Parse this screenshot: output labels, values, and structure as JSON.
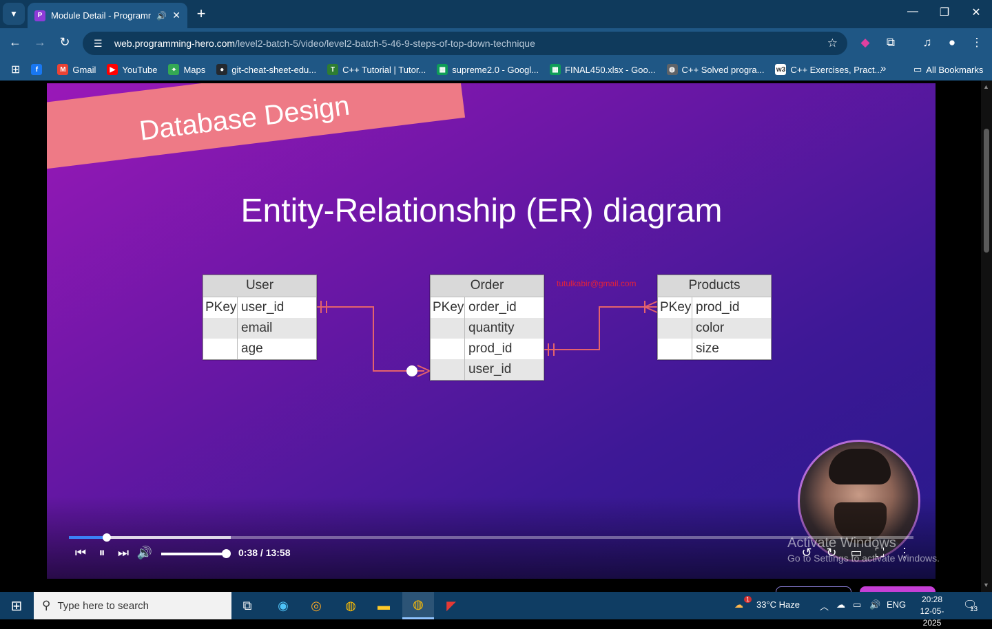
{
  "browser": {
    "tab_title": "Module Detail - Programmi",
    "new_tab": "+",
    "url_domain": "web.programming-hero.com",
    "url_path": "/level2-batch-5/video/level2-batch-5-46-9-steps-of-top-down-technique"
  },
  "bookmarks": [
    {
      "label": "",
      "icon": "facebook-icon",
      "color": "#1877f2"
    },
    {
      "label": "Gmail",
      "icon": "gmail-icon",
      "color": "#ea4335"
    },
    {
      "label": "YouTube",
      "icon": "youtube-icon",
      "color": "#ff0000"
    },
    {
      "label": "Maps",
      "icon": "maps-icon",
      "color": "#34a853"
    },
    {
      "label": "git-cheat-sheet-edu...",
      "icon": "github-icon",
      "color": "#24292f"
    },
    {
      "label": "C++ Tutorial | Tutor...",
      "icon": "tutorial-icon",
      "color": "#2e7d32"
    },
    {
      "label": "supreme2.0 - Googl...",
      "icon": "sheets-icon",
      "color": "#0f9d58"
    },
    {
      "label": "FINAL450.xlsx - Goo...",
      "icon": "sheets-icon",
      "color": "#0f9d58"
    },
    {
      "label": "C++ Solved progra...",
      "icon": "globe-icon",
      "color": "#5f6368"
    },
    {
      "label": "C++ Exercises, Pract...",
      "icon": "w3r-icon",
      "color": "#ffffff"
    }
  ],
  "all_bookmarks": "All Bookmarks",
  "slide": {
    "banner": "Database Design",
    "title": "Entity-Relationship (ER) diagram",
    "email": "tutulkabir@gmail.com",
    "tables": [
      {
        "name": "User",
        "rows": [
          {
            "key": "PKey",
            "field": "user_id"
          },
          {
            "key": "",
            "field": "email"
          },
          {
            "key": "",
            "field": "age"
          }
        ]
      },
      {
        "name": "Order",
        "rows": [
          {
            "key": "PKey",
            "field": "order_id"
          },
          {
            "key": "",
            "field": "quantity"
          },
          {
            "key": "",
            "field": "prod_id"
          },
          {
            "key": "",
            "field": "user_id"
          }
        ]
      },
      {
        "name": "Products",
        "rows": [
          {
            "key": "PKey",
            "field": "prod_id"
          },
          {
            "key": "",
            "field": "color"
          },
          {
            "key": "",
            "field": "size"
          }
        ]
      }
    ]
  },
  "player": {
    "time": "0:38 / 13:58",
    "progress": 0.045,
    "buffered": 0.192,
    "volume": 1.0
  },
  "watermark": {
    "line1": "Activate Windows",
    "line2": "Go to Settings to activate Windows."
  },
  "taskbar": {
    "search_placeholder": "Type here to search",
    "weather": "33°C  Haze",
    "language": "ENG",
    "time": "20:28",
    "date": "12-05-2025",
    "notifications": "13",
    "weather_badge": "1"
  },
  "colors": {
    "chrome_dark": "#0f3a5c",
    "chrome": "#1f5785",
    "accent": "#3b82f6",
    "er_line": "#e5636b"
  }
}
